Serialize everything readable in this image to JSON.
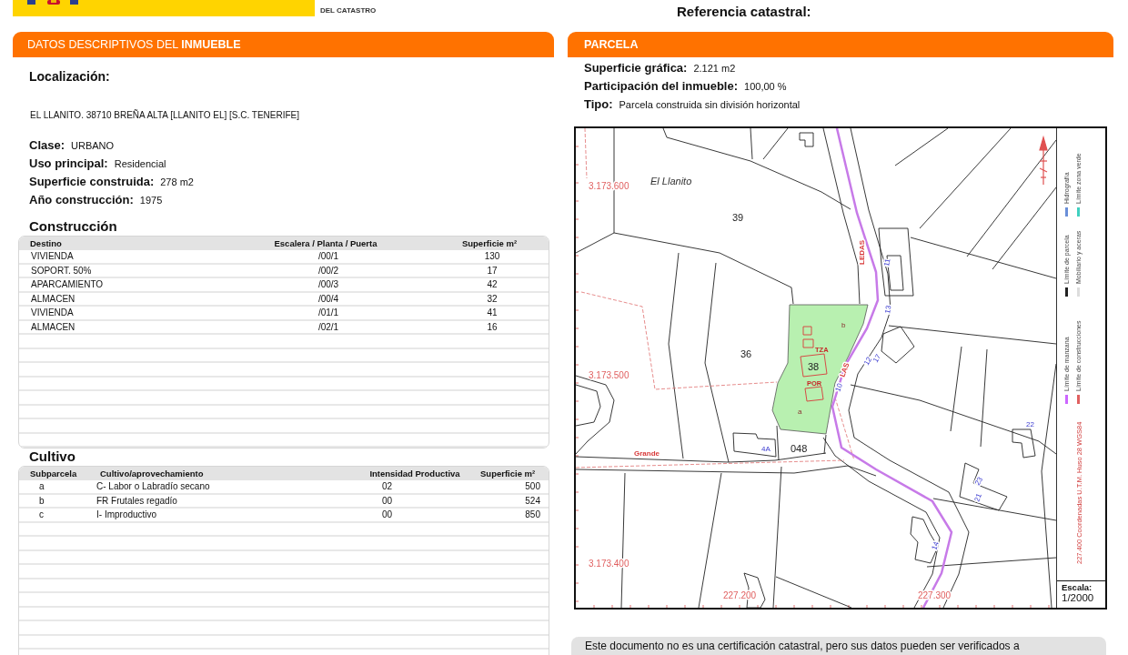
{
  "header": {
    "agency": "DEL CATASTRO",
    "reference_label": "Referencia catastral:"
  },
  "descriptive_data": {
    "title": "DATOS DESCRIPTIVOS DEL **INMUEBLE**",
    "location_label": "Localización:",
    "address": "EL LLANITO. 38710 BREÑA ALTA [LLANITO EL] [S.C. TENERIFE]",
    "fields": [
      {
        "label": "Clase:",
        "value": "URBANO"
      },
      {
        "label": "Uso principal:",
        "value": "Residencial"
      },
      {
        "label": "Superficie construida:",
        "value": "278 m2"
      },
      {
        "label": "Año construcción:",
        "value": "1975"
      }
    ],
    "construction": {
      "title": "Construcción",
      "columns": [
        "Destino",
        "Escalera / Planta / Puerta",
        "Superficie m²"
      ],
      "rows": [
        [
          "VIVIENDA",
          "/00/1",
          "130"
        ],
        [
          "SOPORT. 50%",
          "/00/2",
          "17"
        ],
        [
          "APARCAMIENTO",
          "/00/3",
          "42"
        ],
        [
          "ALMACEN",
          "/00/4",
          "32"
        ],
        [
          "VIVIENDA",
          "/01/1",
          "41"
        ],
        [
          "ALMACEN",
          "/02/1",
          "16"
        ]
      ]
    },
    "cultivation": {
      "title": "Cultivo",
      "columns": [
        "Subparcela",
        "Cultivo/aprovechamiento",
        "Intensidad Productiva",
        "Superficie m²"
      ],
      "rows": [
        [
          "a",
          "C- Labor o Labradío secano",
          "02",
          "500"
        ],
        [
          "b",
          "FR Frutales regadío",
          "00",
          "524"
        ],
        [
          "c",
          "I- Improductivo",
          "00",
          "850"
        ]
      ]
    }
  },
  "parcel": {
    "title": "PARCELA",
    "fields": [
      {
        "label": "Superficie gráfica:",
        "value": "2.121 m2"
      },
      {
        "label": "Participación del inmueble:",
        "value": "100,00 %"
      },
      {
        "label": "Tipo:",
        "value": "Parcela construida sin división horizontal"
      }
    ],
    "map": {
      "labels": [
        {
          "kind": "coordinate",
          "text": "3.173.600"
        },
        {
          "kind": "place",
          "text": "El Llanito"
        },
        {
          "kind": "parcel",
          "text": "39"
        },
        {
          "kind": "street",
          "text": "LEDAS"
        },
        {
          "kind": "house_number",
          "text": "11"
        },
        {
          "kind": "house_number",
          "text": "13"
        },
        {
          "kind": "subparcel",
          "text": "b"
        },
        {
          "kind": "building_code",
          "text": "TZA"
        },
        {
          "kind": "house_number",
          "text": "17"
        },
        {
          "kind": "house_number",
          "text": "12"
        },
        {
          "kind": "parcel",
          "text": "36"
        },
        {
          "kind": "parcel",
          "text": "38"
        },
        {
          "kind": "coordinate",
          "text": "3.173.500"
        },
        {
          "kind": "building_code",
          "text": "POR"
        },
        {
          "kind": "house_number",
          "text": "10"
        },
        {
          "kind": "street",
          "text": "LAS"
        },
        {
          "kind": "subparcel",
          "text": "a"
        },
        {
          "kind": "street",
          "text": "Grande"
        },
        {
          "kind": "house_number",
          "text": "4A"
        },
        {
          "kind": "parcel",
          "text": "048"
        },
        {
          "kind": "house_number",
          "text": "22"
        },
        {
          "kind": "house_number",
          "text": "23"
        },
        {
          "kind": "house_number",
          "text": "21"
        },
        {
          "kind": "house_number",
          "text": "14"
        },
        {
          "kind": "coordinate",
          "text": "3.173.400"
        },
        {
          "kind": "coordinate",
          "text": "227.200"
        },
        {
          "kind": "coordinate",
          "text": "227.300"
        }
      ],
      "legend": [
        {
          "label": "Límite de manzana",
          "color": "#cc66ff"
        },
        {
          "label": "Límite de construcciones",
          "color": "#e06060"
        },
        {
          "label": "Límite de parcela",
          "color": "#222222"
        },
        {
          "label": "Mobiliario y aceras",
          "color": "#dddddd"
        },
        {
          "label": "Hidrografía",
          "color": "#6a8fd8"
        },
        {
          "label": "Límite zona verde",
          "color": "#40d0c0"
        }
      ],
      "coordinate_system": "227.400 Coordenadas U.T.M. Huso 28 WGS84",
      "scale_label": "Escala:",
      "scale": "1/2000"
    }
  },
  "disclaimer": "Este documento no es una certificación catastral, pero sus datos pueden ser verificados a"
}
